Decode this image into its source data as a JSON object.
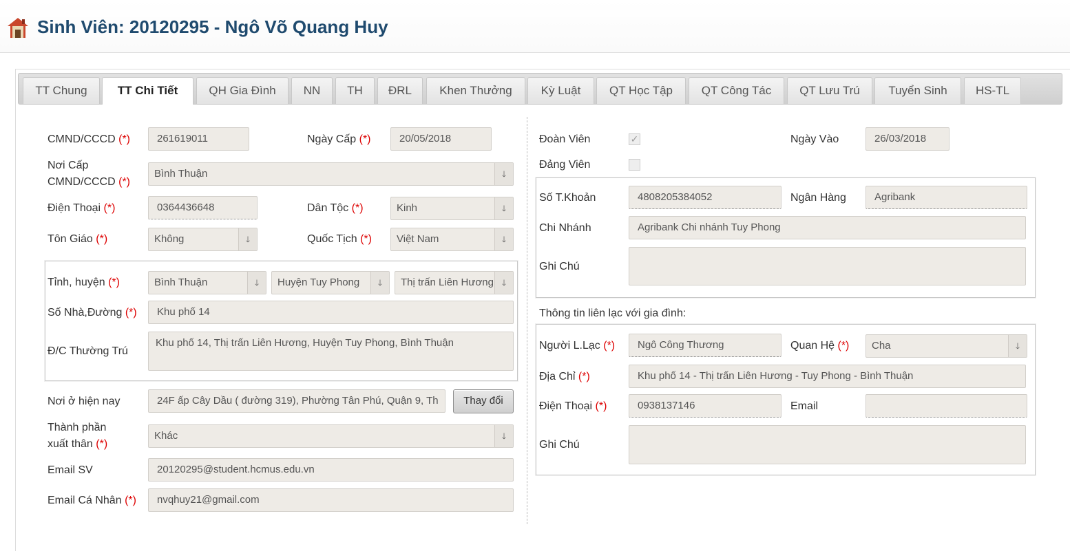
{
  "header": {
    "title": "Sinh Viên: 20120295 - Ngô Võ Quang Huy"
  },
  "tabs": [
    {
      "label": "TT Chung"
    },
    {
      "label": "TT Chi Tiết"
    },
    {
      "label": "QH Gia Đình"
    },
    {
      "label": "NN"
    },
    {
      "label": "TH"
    },
    {
      "label": "ĐRL"
    },
    {
      "label": "Khen Thưởng"
    },
    {
      "label": "Kỳ Luật"
    },
    {
      "label": "QT Học Tập"
    },
    {
      "label": "QT Công Tác"
    },
    {
      "label": "QT Lưu Trú"
    },
    {
      "label": "Tuyển Sinh"
    },
    {
      "label": "HS-TL"
    }
  ],
  "required_mark": "(*)",
  "left": {
    "cmnd": {
      "label": "CMND/CCCD",
      "value": "261619011"
    },
    "ngay_cap": {
      "label": "Ngày Cấp",
      "value": "20/05/2018"
    },
    "noi_cap": {
      "label1": "Nơi Cấp",
      "label2": "CMND/CCCD",
      "value": "Bình Thuận"
    },
    "dien_thoai": {
      "label": "Điện Thoại",
      "value": "0364436648"
    },
    "dan_toc": {
      "label": "Dân Tộc",
      "value": "Kinh"
    },
    "ton_giao": {
      "label": "Tôn Giáo",
      "value": "Không"
    },
    "quoc_tich": {
      "label": "Quốc Tịch",
      "value": "Việt Nam"
    },
    "tinh_huyen": {
      "label": "Tỉnh, huyện",
      "tinh": "Bình Thuận",
      "huyen": "Huyện Tuy Phong",
      "xa": "Thị trấn Liên Hương"
    },
    "so_nha": {
      "label": "Số Nhà,Đường",
      "value": "Khu phố 14"
    },
    "dc_thuong_tru": {
      "label": "Đ/C Thường Trú",
      "value": "Khu phố 14, Thị trấn Liên Hương, Huyện Tuy Phong, Bình Thuận"
    },
    "noi_o": {
      "label": "Nơi ở hiện nay",
      "value": "24F ấp Cây Dầu ( đường 319), Phường Tân Phú, Quận 9, Th",
      "button": "Thay đổi"
    },
    "thanh_phan": {
      "label1": "Thành phần",
      "label2": "xuất thân",
      "value": "Khác"
    },
    "email_sv": {
      "label": "Email SV",
      "value": "20120295@student.hcmus.edu.vn"
    },
    "email_ca_nhan": {
      "label": "Email Cá Nhân",
      "value": "nvqhuy21@gmail.com"
    }
  },
  "right": {
    "doan_vien": {
      "label": "Đoàn Viên",
      "checked": true
    },
    "ngay_vao": {
      "label": "Ngày Vào",
      "value": "26/03/2018"
    },
    "dang_vien": {
      "label": "Đảng Viên",
      "checked": false
    },
    "so_tk": {
      "label": "Số T.Khoản",
      "value": "4808205384052"
    },
    "ngan_hang": {
      "label": "Ngân Hàng",
      "value": "Agribank"
    },
    "chi_nhanh": {
      "label": "Chi Nhánh",
      "value": "Agribank Chi nhánh Tuy Phong"
    },
    "ghi_chu_bank": {
      "label": "Ghi Chú",
      "value": ""
    },
    "family_heading": "Thông tin liên lạc với gia đình:",
    "nguoi_lien_lac": {
      "label": "Người L.Lạc",
      "value": "Ngô Công Thương"
    },
    "quan_he": {
      "label": "Quan Hệ",
      "value": "Cha"
    },
    "dia_chi": {
      "label": "Địa Chỉ",
      "value": "Khu phố 14 - Thị trấn Liên Hương - Tuy Phong - Bình Thuận"
    },
    "dien_thoai_gd": {
      "label": "Điện Thoại",
      "value": "0938137146"
    },
    "email_gd": {
      "label": "Email",
      "value": ""
    },
    "ghi_chu_gd": {
      "label": "Ghi Chú",
      "value": ""
    }
  },
  "icons": {
    "home": "home-icon",
    "dropdown": "chevron-down-icon",
    "checkbox": "check-icon"
  }
}
